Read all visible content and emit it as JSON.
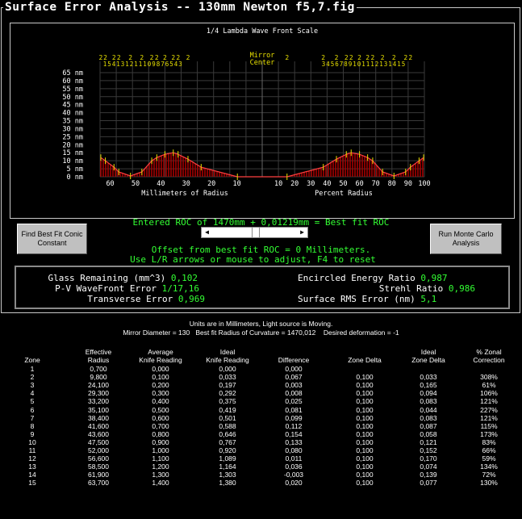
{
  "window": {
    "title": "Surface Error Analysis -- 130mm Newton f5,7.fig"
  },
  "chart_data": {
    "type": "area",
    "title": "1/4 Lambda Wave Front Scale",
    "ylabel_unit": "nm",
    "y_ticks": [
      "65 nm",
      "60 nm",
      "55 nm",
      "50 nm",
      "45 nm",
      "40 nm",
      "35 nm",
      "30 nm",
      "25 nm",
      "20 nm",
      "15 nm",
      "10 nm",
      "5 nm",
      "0 nm"
    ],
    "ylim": [
      0,
      65
    ],
    "x_left_ticks": [
      "60",
      "50",
      "40",
      "30",
      "20",
      "10"
    ],
    "x_right_ticks": [
      "10",
      "20",
      "30",
      "40",
      "50",
      "60",
      "70",
      "80",
      "90",
      "100"
    ],
    "xlabel_left": "Millimeters of Radius",
    "xlabel_right": "Percent Radius",
    "center_label_1": "Mirror",
    "center_label_2": "Center",
    "zone_markers_left": [
      "2",
      "2",
      "2",
      "2",
      "2",
      "2",
      "2",
      "2",
      "2",
      "2",
      "2",
      "2"
    ],
    "zone_markers_left_sub": [
      "1",
      "5",
      "4",
      "1",
      "3",
      "1",
      "2",
      "1",
      "1",
      "1",
      "0",
      "9",
      "8",
      "7",
      "6",
      "5",
      "4",
      "3"
    ],
    "zone_markers_right": [
      "2",
      "2",
      "2",
      "2",
      "2",
      "2",
      "2",
      "2",
      "2",
      "2",
      "2",
      "2"
    ],
    "zone_markers_right_sub": [
      "3",
      "4",
      "5",
      "6",
      "7",
      "8",
      "9",
      "1",
      "0",
      "1",
      "1",
      "1",
      "2",
      "1",
      "3",
      "1",
      "4",
      "1",
      "5"
    ],
    "profile": [
      [
        -63.7,
        12
      ],
      [
        -61.9,
        10
      ],
      [
        -58.5,
        6
      ],
      [
        -56.6,
        3
      ],
      [
        -52,
        0.5
      ],
      [
        -47.5,
        3
      ],
      [
        -43.6,
        10
      ],
      [
        -41.6,
        12
      ],
      [
        -38.4,
        14
      ],
      [
        -35.1,
        15
      ],
      [
        -33.2,
        14
      ],
      [
        -29.3,
        11
      ],
      [
        -24.1,
        6
      ],
      [
        -9.8,
        0
      ],
      [
        9.8,
        0
      ],
      [
        24.1,
        6
      ],
      [
        29.3,
        11
      ],
      [
        33.2,
        14
      ],
      [
        35.1,
        15
      ],
      [
        38.4,
        14
      ],
      [
        41.6,
        12
      ],
      [
        43.6,
        10
      ],
      [
        47.5,
        3
      ],
      [
        52,
        0.5
      ],
      [
        56.6,
        3
      ],
      [
        58.5,
        6
      ],
      [
        61.9,
        10
      ],
      [
        63.7,
        12
      ]
    ],
    "grid": true
  },
  "controls": {
    "find_best_fit_label": "Find Best Fit Conic Constant",
    "monte_carlo_label": "Run Monte Carlo Analysis",
    "roc_text": "Entered ROC of 1470mm + 0,01219mm = Best fit ROC",
    "offset_text": "Offset from best fit ROC = 0 Millimeters.",
    "adjust_text": "Use L/R arrows or mouse to adjust, F4 to reset",
    "slider_left": "◀",
    "slider_right": "▶",
    "slider_position": 0.5
  },
  "stats": {
    "glass_label": "Glass Remaining (mm^3)",
    "glass_value": "0,102",
    "pv_label": "P-V WaveFront Error",
    "pv_value": "1/17,16",
    "transverse_label": "Transverse Error",
    "transverse_value": "0,969",
    "encircled_label": "Encircled Energy Ratio",
    "encircled_value": "0,987",
    "strehl_label": "Strehl Ratio",
    "strehl_value": "0,986",
    "rms_label": "Surface RMS Error (nm)",
    "rms_value": "5,1"
  },
  "info": {
    "units_text": "Units are in Millimeters, Light source is Moving.",
    "mirror_diameter": "Mirror Diameter = 130",
    "best_fit_radius": "Best fit Radius of Curvature = 1470,012",
    "desired_deformation": "Desired deformation = -1"
  },
  "table": {
    "headers": [
      [
        "",
        "Zone"
      ],
      [
        "Effective",
        "Radius"
      ],
      [
        "Average",
        "Knife Reading"
      ],
      [
        "Ideal",
        "Knife Reading"
      ],
      [
        "",
        "Difference"
      ],
      [
        "",
        "Zone Delta"
      ],
      [
        "Ideal",
        "Zone Delta"
      ],
      [
        "% Zonal",
        "Correction"
      ]
    ],
    "rows": [
      [
        "1",
        "0,700",
        "0,000",
        "0,000",
        "0,000",
        "",
        "",
        ""
      ],
      [
        "2",
        "9,800",
        "0,100",
        "0,033",
        "0,067",
        "0,100",
        "0,033",
        "308%"
      ],
      [
        "3",
        "24,100",
        "0,200",
        "0,197",
        "0,003",
        "0,100",
        "0,165",
        "61%"
      ],
      [
        "4",
        "29,300",
        "0,300",
        "0,292",
        "0,008",
        "0,100",
        "0,094",
        "106%"
      ],
      [
        "5",
        "33,200",
        "0,400",
        "0,375",
        "0,025",
        "0,100",
        "0,083",
        "121%"
      ],
      [
        "6",
        "35,100",
        "0,500",
        "0,419",
        "0,081",
        "0,100",
        "0,044",
        "227%"
      ],
      [
        "7",
        "38,400",
        "0,600",
        "0,501",
        "0,099",
        "0,100",
        "0,083",
        "121%"
      ],
      [
        "8",
        "41,600",
        "0,700",
        "0,588",
        "0,112",
        "0,100",
        "0,087",
        "115%"
      ],
      [
        "9",
        "43,600",
        "0,800",
        "0,646",
        "0,154",
        "0,100",
        "0,058",
        "173%"
      ],
      [
        "10",
        "47,500",
        "0,900",
        "0,767",
        "0,133",
        "0,100",
        "0,121",
        "83%"
      ],
      [
        "11",
        "52,000",
        "1,000",
        "0,920",
        "0,080",
        "0,100",
        "0,152",
        "66%"
      ],
      [
        "12",
        "56,600",
        "1,100",
        "1,089",
        "0,011",
        "0,100",
        "0,170",
        "59%"
      ],
      [
        "13",
        "58,500",
        "1,200",
        "1,164",
        "0,036",
        "0,100",
        "0,074",
        "134%"
      ],
      [
        "14",
        "61,900",
        "1,300",
        "1,303",
        "-0,003",
        "0,100",
        "0,139",
        "72%"
      ],
      [
        "15",
        "63,700",
        "1,400",
        "1,380",
        "0,020",
        "0,100",
        "0,077",
        "130%"
      ]
    ]
  },
  "colors": {
    "text_green": "#33ff33",
    "marker_yellow": "#e8e000",
    "bar_red": "#b00000",
    "curve": "#ff4040",
    "grid": "#3a3a3a"
  }
}
